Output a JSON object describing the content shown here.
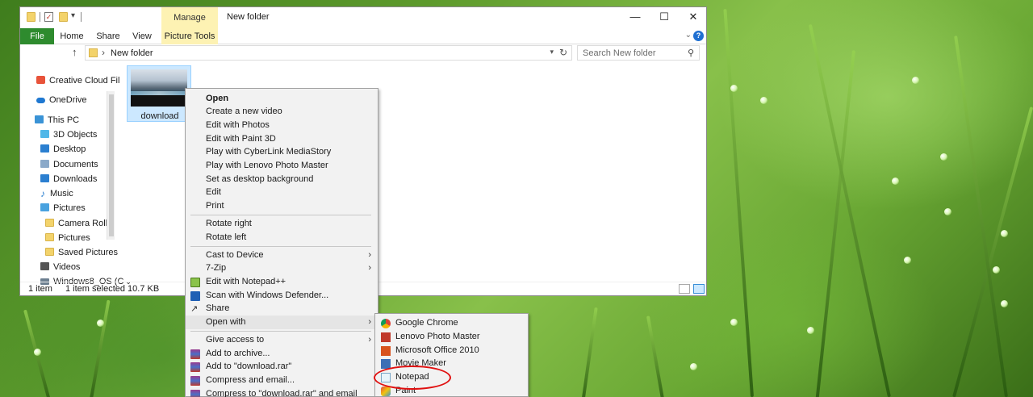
{
  "window": {
    "title": "New folder",
    "manage_tab": "Manage",
    "minimize_glyph": "—",
    "maximize_glyph": "☐",
    "close_glyph": "✕"
  },
  "ribbon": {
    "tabs": [
      {
        "label": "File"
      },
      {
        "label": "Home"
      },
      {
        "label": "Share"
      },
      {
        "label": "View"
      },
      {
        "label": "Picture Tools"
      }
    ],
    "expand_glyph": "⌄",
    "help_glyph": "?"
  },
  "address": {
    "path": "New folder",
    "search_placeholder": "Search New folder"
  },
  "nav": {
    "items": [
      {
        "label": "Creative Cloud Fil",
        "icon": "creative-cloud-icon"
      },
      {
        "label": "OneDrive",
        "icon": "onedrive-icon"
      },
      {
        "label": "This PC",
        "icon": "computer-icon"
      },
      {
        "label": "3D Objects",
        "icon": "3d-objects-icon"
      },
      {
        "label": "Desktop",
        "icon": "desktop-icon"
      },
      {
        "label": "Documents",
        "icon": "documents-icon"
      },
      {
        "label": "Downloads",
        "icon": "downloads-icon"
      },
      {
        "label": "Music",
        "icon": "music-icon"
      },
      {
        "label": "Pictures",
        "icon": "pictures-icon"
      },
      {
        "label": "Camera Roll",
        "icon": "folder-icon"
      },
      {
        "label": "Pictures",
        "icon": "folder-icon"
      },
      {
        "label": "Saved Pictures",
        "icon": "folder-icon"
      },
      {
        "label": "Videos",
        "icon": "videos-icon"
      },
      {
        "label": "Windows8_OS (C",
        "icon": "drive-icon"
      }
    ]
  },
  "files": [
    {
      "name": "download",
      "selected": true
    }
  ],
  "status": {
    "count": "1 item",
    "selection": "1 item selected  10.7 KB"
  },
  "context_menu": {
    "items": [
      {
        "label": "Open",
        "bold": true
      },
      {
        "label": "Create a new video"
      },
      {
        "label": "Edit with Photos"
      },
      {
        "label": "Edit with Paint 3D"
      },
      {
        "label": "Play with CyberLink MediaStory"
      },
      {
        "label": "Play with Lenovo Photo Master"
      },
      {
        "label": "Set as desktop background"
      },
      {
        "label": "Edit"
      },
      {
        "label": "Print"
      },
      {
        "label": "Rotate right"
      },
      {
        "label": "Rotate left"
      },
      {
        "label": "Cast to Device",
        "submenu": true
      },
      {
        "label": "7-Zip",
        "submenu": true
      },
      {
        "label": "Edit with Notepad++",
        "icon": "notepad-plus-plus-icon"
      },
      {
        "label": "Scan with Windows Defender...",
        "icon": "windows-defender-icon"
      },
      {
        "label": "Share",
        "icon": "share-icon"
      },
      {
        "label": "Open with",
        "submenu": true
      },
      {
        "label": "Give access to",
        "submenu": true
      },
      {
        "label": "Add to archive...",
        "icon": "winrar-icon"
      },
      {
        "label": "Add to \"download.rar\"",
        "icon": "winrar-icon"
      },
      {
        "label": "Compress and email...",
        "icon": "winrar-icon"
      },
      {
        "label": "Compress to \"download.rar\" and email",
        "icon": "winrar-icon"
      }
    ],
    "submenu_glyph": "›"
  },
  "open_with": {
    "items": [
      {
        "label": "Google Chrome",
        "icon": "chrome-icon"
      },
      {
        "label": "Lenovo Photo Master",
        "icon": "lenovo-photo-master-icon"
      },
      {
        "label": "Microsoft Office 2010",
        "icon": "office-icon"
      },
      {
        "label": "Movie Maker",
        "icon": "movie-maker-icon"
      },
      {
        "label": "Notepad",
        "icon": "notepad-icon",
        "highlighted": true
      },
      {
        "label": "Paint",
        "icon": "paint-icon"
      }
    ]
  },
  "colors": {
    "file_tab": "#2e8b2e",
    "picture_tools": "#fdf2b3",
    "selection": "#cce8ff",
    "highlight_ring": "#e01010"
  }
}
